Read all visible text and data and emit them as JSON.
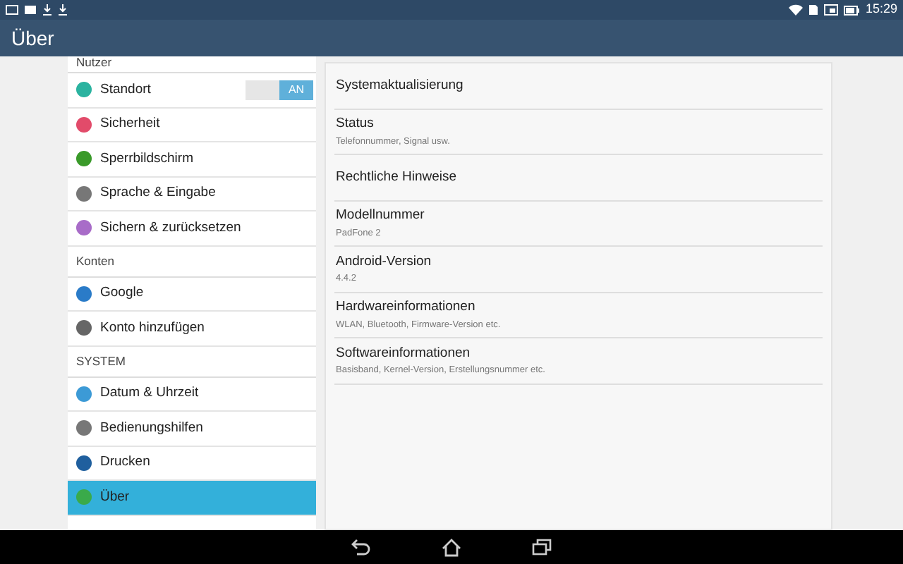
{
  "status_bar": {
    "time": "15:29"
  },
  "app_bar": {
    "title": "Über"
  },
  "sidebar": {
    "sections": [
      {
        "header": "Nutzer",
        "items": [
          {
            "label": "Standort",
            "kind": "toggle",
            "color": "#2bb3a0",
            "selected": false,
            "toggle": {
              "label": "AN",
              "on": true
            }
          },
          {
            "label": "Sicherheit",
            "kind": "plain",
            "color": "#e24b6a",
            "selected": false
          },
          {
            "label": "Sperrbildschirm",
            "kind": "plain",
            "color": "#3a9a2a",
            "selected": false
          },
          {
            "label": "Sprache & Eingabe",
            "kind": "plain",
            "color": "#777777",
            "selected": false
          },
          {
            "label": "Sichern & zurücksetzen",
            "kind": "plain",
            "color": "#a86cc8",
            "selected": false
          }
        ]
      },
      {
        "header": "Konten",
        "items": [
          {
            "label": "Google",
            "kind": "plain",
            "color": "#2a7bc8",
            "selected": false
          },
          {
            "label": "Konto hinzufügen",
            "kind": "plain",
            "color": "#666666",
            "selected": false
          }
        ]
      },
      {
        "header": "SYSTEM",
        "items": [
          {
            "label": "Datum & Uhrzeit",
            "kind": "plain",
            "color": "#3c9ad6",
            "selected": false
          },
          {
            "label": "Bedienungshilfen",
            "kind": "plain",
            "color": "#777777",
            "selected": false
          },
          {
            "label": "Drucken",
            "kind": "plain",
            "color": "#1f5f9e",
            "selected": false
          },
          {
            "label": "Über",
            "kind": "plain",
            "color": "#3aaa4a",
            "selected": true
          }
        ]
      }
    ]
  },
  "details": [
    {
      "title": "Systemaktualisierung"
    },
    {
      "title": "Status",
      "subtitle": "Telefonnummer, Signal usw."
    },
    {
      "title": "Rechtliche Hinweise"
    },
    {
      "title": "Modellnummer",
      "subtitle": "PadFone 2"
    },
    {
      "title": "Android-Version",
      "subtitle": "4.4.2"
    },
    {
      "title": "Hardwareinformationen",
      "subtitle": "WLAN, Bluetooth, Firmware-Version etc."
    },
    {
      "title": "Softwareinformationen",
      "subtitle": "Basisband, Kernel-Version, Erstellungsnummer etc."
    }
  ]
}
